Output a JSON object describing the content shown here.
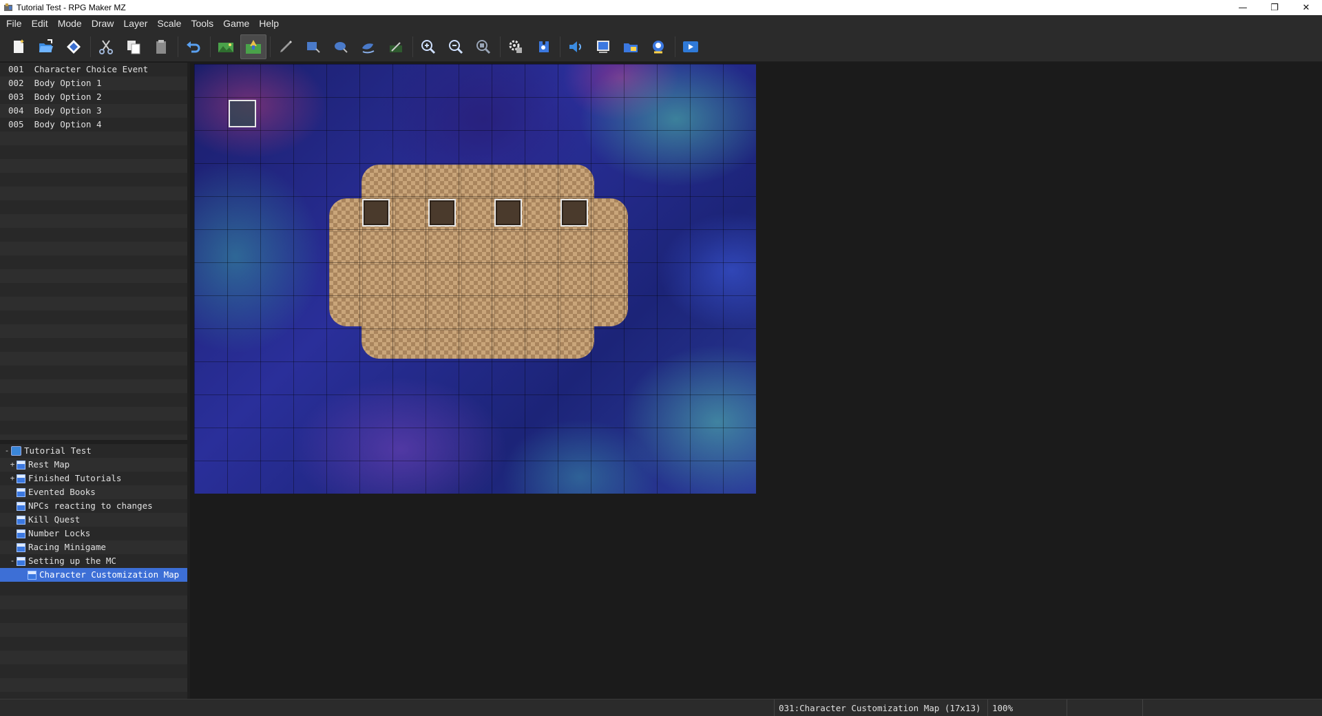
{
  "window": {
    "title": "Tutorial Test - RPG Maker MZ",
    "controls": {
      "minimize": "—",
      "restore": "❐",
      "close": "✕"
    }
  },
  "menu": [
    "File",
    "Edit",
    "Mode",
    "Draw",
    "Layer",
    "Scale",
    "Tools",
    "Game",
    "Help"
  ],
  "toolbar": {
    "buttons": [
      "new-project-icon",
      "open-project-icon",
      "save-project-icon",
      "cut-icon",
      "copy-icon",
      "paste-icon",
      "undo-icon",
      "map-mode-icon",
      "event-mode-icon",
      "pencil-icon",
      "rectangle-icon",
      "ellipse-icon",
      "flood-fill-icon",
      "shadow-pen-icon",
      "zoom-in-icon",
      "zoom-out-icon",
      "actual-size-icon",
      "database-icon",
      "plugin-manager-icon",
      "sound-test-icon",
      "event-searcher-icon",
      "resource-manager-icon",
      "character-generator-icon",
      "playtest-icon"
    ],
    "active": "event-mode-icon"
  },
  "events": [
    {
      "id": "001",
      "name": "Character Choice Event"
    },
    {
      "id": "002",
      "name": "Body Option 1"
    },
    {
      "id": "003",
      "name": "Body Option 2"
    },
    {
      "id": "004",
      "name": "Body Option 3"
    },
    {
      "id": "005",
      "name": "Body Option 4"
    }
  ],
  "map_tree": [
    {
      "label": "Tutorial Test",
      "expander": "-",
      "type": "project",
      "level": 0
    },
    {
      "label": "Rest Map",
      "expander": "+",
      "type": "map",
      "level": 1
    },
    {
      "label": "Finished Tutorials",
      "expander": "+",
      "type": "map",
      "level": 1
    },
    {
      "label": "Evented Books",
      "expander": "",
      "type": "map",
      "level": 1
    },
    {
      "label": "NPCs reacting to changes",
      "expander": "",
      "type": "map",
      "level": 1
    },
    {
      "label": "Kill Quest",
      "expander": "",
      "type": "map",
      "level": 1
    },
    {
      "label": "Number Locks",
      "expander": "",
      "type": "map",
      "level": 1
    },
    {
      "label": "Racing Minigame",
      "expander": "",
      "type": "map",
      "level": 1
    },
    {
      "label": "Setting up the MC",
      "expander": "-",
      "type": "map",
      "level": 1
    },
    {
      "label": "Character Customization Map",
      "expander": "",
      "type": "map",
      "level": 2,
      "selected": true
    }
  ],
  "map": {
    "width_tiles": 17,
    "height_tiles": 13
  },
  "status": {
    "map_info": "031:Character Customization Map (17x13)",
    "zoom": "100%"
  },
  "colors": {
    "selection": "#3d6fd6",
    "panel_bg": "#282828",
    "background": "#1b1b1b"
  }
}
